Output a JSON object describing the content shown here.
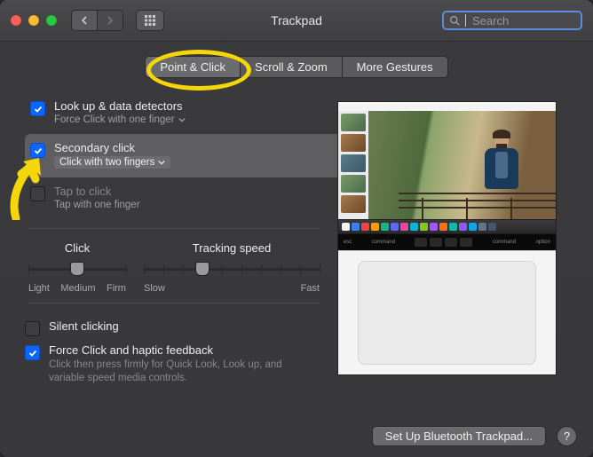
{
  "window": {
    "title": "Trackpad"
  },
  "toolbar": {
    "search_placeholder": "Search",
    "search_value": ""
  },
  "tabs": [
    {
      "label": "Point & Click",
      "active": true
    },
    {
      "label": "Scroll & Zoom",
      "active": false
    },
    {
      "label": "More Gestures",
      "active": false
    }
  ],
  "options": {
    "lookup": {
      "checked": true,
      "label": "Look up & data detectors",
      "sub": "Force Click with one finger"
    },
    "secondary": {
      "checked": true,
      "selected": true,
      "label": "Secondary click",
      "sub": "Click with two fingers"
    },
    "tap": {
      "checked": false,
      "label": "Tap to click",
      "sub": "Tap with one finger"
    }
  },
  "sliders": {
    "click": {
      "label": "Click",
      "ticks": [
        "Light",
        "Medium",
        "Firm"
      ],
      "value_index": 1
    },
    "speed": {
      "label": "Tracking speed",
      "ticks_min": "Slow",
      "ticks_max": "Fast",
      "count": 10,
      "value_index": 3
    }
  },
  "extra": {
    "silent": {
      "checked": false,
      "label": "Silent clicking"
    },
    "force": {
      "checked": true,
      "label": "Force Click and haptic feedback",
      "sub": "Click then press firmly for Quick Look, Look up, and variable speed media controls."
    }
  },
  "footer": {
    "bluetooth": "Set Up Bluetooth Trackpad...",
    "help": "?"
  },
  "annotation": {
    "highlight_tab": 0
  },
  "dock_colors": [
    "#f4f4f6",
    "#3b82f6",
    "#ef4444",
    "#f59e0b",
    "#10b981",
    "#6366f1",
    "#ec4899",
    "#06b6d4",
    "#84cc16",
    "#a855f7",
    "#f97316",
    "#14b8a6",
    "#8b5cf6",
    "#0ea5e9",
    "#64748b",
    "#475569"
  ]
}
